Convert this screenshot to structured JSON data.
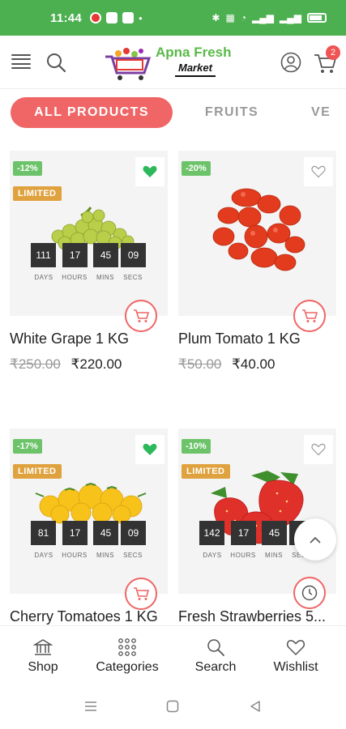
{
  "status_bar": {
    "time": "11:44"
  },
  "header": {
    "logo_line1": "Apna Fresh",
    "logo_line2": "Market",
    "cart_count": "2"
  },
  "tabs": [
    {
      "label": "ALL PRODUCTS",
      "active": true
    },
    {
      "label": "FRUITS",
      "active": false
    },
    {
      "label": "VE",
      "active": false
    }
  ],
  "countdown_labels": [
    "DAYS",
    "HOURS",
    "MINS",
    "SECS"
  ],
  "products": [
    {
      "title": "White Grape 1 KG",
      "old_price": "₹250.00",
      "new_price": "₹220.00",
      "discount": "-12%",
      "limited": "LIMITED",
      "wishlisted": true,
      "countdown": [
        "111",
        "17",
        "45",
        "09"
      ]
    },
    {
      "title": "Plum Tomato 1 KG",
      "old_price": "₹50.00",
      "new_price": "₹40.00",
      "discount": "-20%",
      "limited": "",
      "wishlisted": false,
      "countdown": []
    },
    {
      "title": "Cherry Tomatoes 1 KG",
      "old_price": "",
      "new_price": "",
      "discount": "-17%",
      "limited": "LIMITED",
      "wishlisted": true,
      "countdown": [
        "81",
        "17",
        "45",
        "09"
      ]
    },
    {
      "title": "Fresh Strawberries 5...",
      "old_price": "",
      "new_price": "",
      "discount": "-10%",
      "limited": "LIMITED",
      "wishlisted": false,
      "countdown": [
        "142",
        "17",
        "45",
        "09"
      ]
    }
  ],
  "bottom_nav": [
    {
      "label": "Shop",
      "icon": "shop-icon"
    },
    {
      "label": "Categories",
      "icon": "categories-icon"
    },
    {
      "label": "Search",
      "icon": "search-icon"
    },
    {
      "label": "Wishlist",
      "icon": "heart-icon"
    }
  ],
  "colors": {
    "status_bar": "#4caf50",
    "accent": "#f06565",
    "discount": "#6cc36a",
    "limited": "#e0a23f",
    "heart_active": "#2eb85c"
  }
}
